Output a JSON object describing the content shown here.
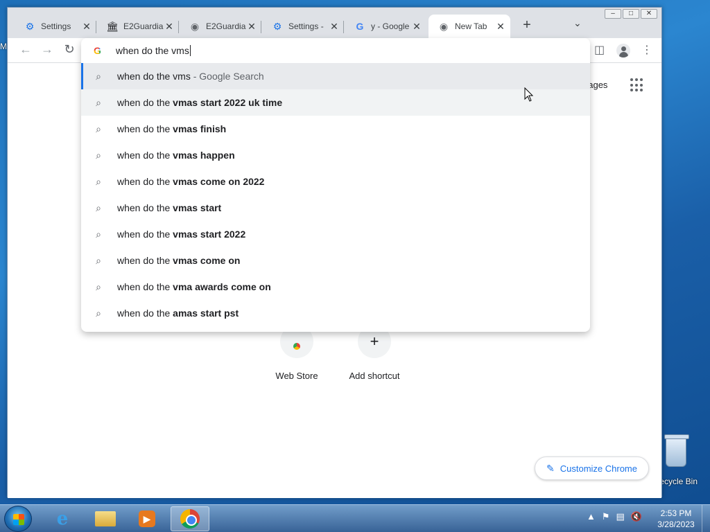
{
  "browser": {
    "tabs": [
      {
        "title": "Settings",
        "icon": "gear-icon"
      },
      {
        "title": "E2Guardia",
        "icon": "e2guardian-icon"
      },
      {
        "title": "E2Guardia",
        "icon": "globe-icon"
      },
      {
        "title": "Settings -",
        "icon": "gear-icon"
      },
      {
        "title": "y - Google",
        "icon": "google-icon"
      },
      {
        "title": "New Tab",
        "icon": "chrome-icon"
      }
    ],
    "omnibox_text": "when do the vms"
  },
  "suggestions": [
    {
      "prefix": "when do the vms",
      "bold": "",
      "suffix": " - Google Search"
    },
    {
      "prefix": "when do the ",
      "bold": "vmas start 2022 uk time",
      "suffix": ""
    },
    {
      "prefix": "when do the ",
      "bold": "vmas finish",
      "suffix": ""
    },
    {
      "prefix": "when do the ",
      "bold": "vmas happen",
      "suffix": ""
    },
    {
      "prefix": "when do the ",
      "bold": "vmas come on 2022",
      "suffix": ""
    },
    {
      "prefix": "when do the ",
      "bold": "vmas start",
      "suffix": ""
    },
    {
      "prefix": "when do the ",
      "bold": "vmas start 2022",
      "suffix": ""
    },
    {
      "prefix": "when do the ",
      "bold": "vmas come on",
      "suffix": ""
    },
    {
      "prefix": "when do the ",
      "bold": "vma awards come on",
      "suffix": ""
    },
    {
      "prefix": "when do the ",
      "bold": "amas start pst",
      "suffix": ""
    }
  ],
  "new_tab_page": {
    "images_link": "nages",
    "shortcuts": [
      {
        "label": "Web Store"
      },
      {
        "label": "Add shortcut"
      }
    ],
    "customize_label": "Customize Chrome"
  },
  "desktop": {
    "recycle_bin_label": "ecycle Bin",
    "edge_letter": "M"
  },
  "taskbar": {
    "time": "2:53 PM",
    "date": "3/28/2023"
  },
  "colors": {
    "accent": "#1a73e8",
    "tabstrip": "#dee1e6"
  }
}
